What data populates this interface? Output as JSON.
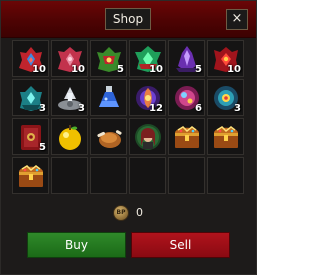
{
  "window": {
    "tab_label": "Shop",
    "close_label": "×"
  },
  "slots": [
    {
      "item": "red-helmet-icon",
      "qty": "10"
    },
    {
      "item": "pink-helmet-icon",
      "qty": "10"
    },
    {
      "item": "green-helmet-icon",
      "qty": "5"
    },
    {
      "item": "emerald-helmet-icon",
      "qty": "10"
    },
    {
      "item": "purple-crystal-icon",
      "qty": "5"
    },
    {
      "item": "crimson-helmet-icon",
      "qty": "10"
    },
    {
      "item": "teal-helmet-icon",
      "qty": "3"
    },
    {
      "item": "silver-helm-icon",
      "qty": "3"
    },
    {
      "item": "blue-potion-icon",
      "qty": ""
    },
    {
      "item": "purple-orb-icon",
      "qty": "12"
    },
    {
      "item": "pink-orb-icon",
      "qty": "6"
    },
    {
      "item": "teal-orb-icon",
      "qty": "3"
    },
    {
      "item": "red-book-icon",
      "qty": "5"
    },
    {
      "item": "golden-apple-icon",
      "qty": ""
    },
    {
      "item": "roast-chicken-icon",
      "qty": ""
    },
    {
      "item": "hero-portrait-icon",
      "qty": ""
    },
    {
      "item": "treasure-chest-icon",
      "qty": ""
    },
    {
      "item": "treasure-chest-icon",
      "qty": ""
    },
    {
      "item": "treasure-chest-icon",
      "qty": ""
    },
    {
      "item": "",
      "qty": ""
    },
    {
      "item": "",
      "qty": ""
    },
    {
      "item": "",
      "qty": ""
    },
    {
      "item": "",
      "qty": ""
    },
    {
      "item": "",
      "qty": ""
    }
  ],
  "currency": {
    "icon": "bp-coin-icon",
    "coin_text": "BP",
    "amount": "0"
  },
  "buttons": {
    "buy_label": "Buy",
    "sell_label": "Sell"
  },
  "colors": {
    "buy": "#1f7a1b",
    "sell": "#9f0f17",
    "title_bar": "#5a0404"
  }
}
